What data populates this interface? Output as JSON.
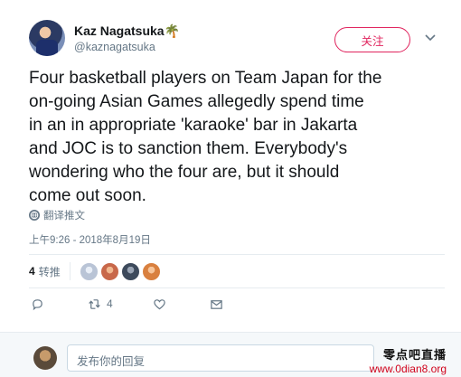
{
  "header": {
    "display_name": "Kaz Nagatsuka",
    "name_emoji": "🌴",
    "handle": "@kaznagatsuka",
    "follow_label": "关注"
  },
  "tweet": {
    "lines": [
      "Four basketball players on Team Japan for the",
      "on-going Asian Games allegedly spend time",
      "in an in appropriate 'karaoke' bar in Jakarta",
      "and JOC is to sanction them. Everybody's",
      "wondering who the four are, but it should",
      "come out soon."
    ],
    "translate_label": "翻译推文",
    "timestamp": "上午9:26 - 2018年8月19日"
  },
  "stats": {
    "retweet_count": "4",
    "retweet_label": "转推",
    "retweeter_avatars": [
      "#b9c4d6",
      "#c8684a",
      "#3d4a5c",
      "#d9803f"
    ]
  },
  "actions": {
    "reply_icon": "reply-icon",
    "retweet_icon": "retweet-icon",
    "retweet_count": "4",
    "like_icon": "heart-icon",
    "message_icon": "envelope-icon"
  },
  "reply": {
    "placeholder": "发布你的回复"
  },
  "watermark": {
    "title": "零点吧直播",
    "url": "www.0dian8.org"
  },
  "colors": {
    "accent": "#e0245e",
    "secondary_text": "#657786",
    "watermark_url": "#d0021b"
  }
}
